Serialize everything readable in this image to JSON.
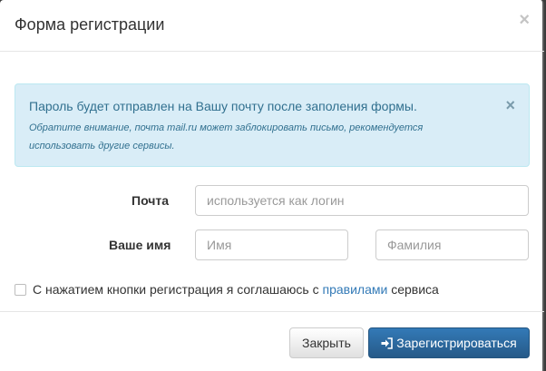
{
  "modal": {
    "title": "Форма регистрации",
    "close_glyph": "×"
  },
  "alert": {
    "main": "Пароль будет отправлен на Вашу почту после заполения формы.",
    "note": "Обратите внимание, почта mail.ru может заблокировать письмо, рекомендуется использовать другие сервисы.",
    "close_glyph": "×"
  },
  "form": {
    "email_label": "Почта",
    "email_placeholder": "используется как логин",
    "name_label": "Ваше имя",
    "first_name_placeholder": "Имя",
    "last_name_placeholder": "Фамилия",
    "agree_prefix": "С нажатием кнопки регистрация я соглашаюсь с",
    "agree_link": "правилами",
    "agree_suffix": "сервиса",
    "agree_checked": false
  },
  "footer": {
    "close_label": "Закрыть",
    "register_label": "Зарегистрироваться",
    "register_icon": "sign-in-icon"
  },
  "colors": {
    "primary": "#337ab7",
    "alert_bg": "#d9edf7",
    "alert_text": "#31708f"
  }
}
